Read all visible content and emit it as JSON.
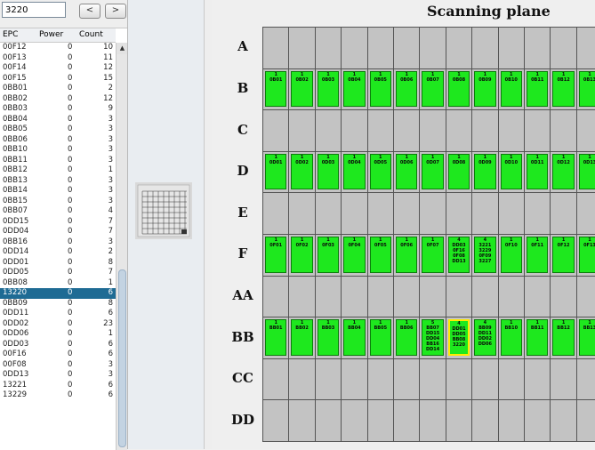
{
  "search": {
    "value": "3220"
  },
  "nav": {
    "prev": "<",
    "next": ">"
  },
  "table": {
    "headers": [
      "EPC",
      "Power",
      "Count"
    ],
    "rows": [
      [
        "00F12",
        "0",
        "10"
      ],
      [
        "00F13",
        "0",
        "11"
      ],
      [
        "00F14",
        "0",
        "12"
      ],
      [
        "00F15",
        "0",
        "15"
      ],
      [
        "0BB01",
        "0",
        "2"
      ],
      [
        "0BB02",
        "0",
        "12"
      ],
      [
        "0BB03",
        "0",
        "9"
      ],
      [
        "0BB04",
        "0",
        "3"
      ],
      [
        "0BB05",
        "0",
        "3"
      ],
      [
        "0BB06",
        "0",
        "3"
      ],
      [
        "0BB10",
        "0",
        "3"
      ],
      [
        "0BB11",
        "0",
        "3"
      ],
      [
        "0BB12",
        "0",
        "1"
      ],
      [
        "0BB13",
        "0",
        "3"
      ],
      [
        "0BB14",
        "0",
        "3"
      ],
      [
        "0BB15",
        "0",
        "3"
      ],
      [
        "0BB07",
        "0",
        "4"
      ],
      [
        "0DD15",
        "0",
        "7"
      ],
      [
        "0DD04",
        "0",
        "7"
      ],
      [
        "0BB16",
        "0",
        "3"
      ],
      [
        "0DD14",
        "0",
        "2"
      ],
      [
        "0DD01",
        "0",
        "8"
      ],
      [
        "0DD05",
        "0",
        "7"
      ],
      [
        "0BB08",
        "0",
        "1"
      ],
      [
        "13220",
        "0",
        "6"
      ],
      [
        "0BB09",
        "0",
        "8"
      ],
      [
        "0DD11",
        "0",
        "6"
      ],
      [
        "0DD02",
        "0",
        "23"
      ],
      [
        "0DD06",
        "0",
        "1"
      ],
      [
        "0DD03",
        "0",
        "6"
      ],
      [
        "00F16",
        "0",
        "6"
      ],
      [
        "00F08",
        "0",
        "3"
      ],
      [
        "0DD13",
        "0",
        "3"
      ],
      [
        "13221",
        "0",
        "6"
      ],
      [
        "13229",
        "0",
        "6"
      ]
    ],
    "selected_index": 24
  },
  "scanning_plane": {
    "title": "Scanning plane",
    "row_labels": [
      "A",
      "B",
      "C",
      "D",
      "E",
      "F",
      "AA",
      "BB",
      "CC",
      "DD"
    ],
    "rows": {
      "B": [
        {
          "count": "1",
          "ids": [
            "0B01"
          ]
        },
        {
          "count": "1",
          "ids": [
            "0B02"
          ]
        },
        {
          "count": "1",
          "ids": [
            "0B03"
          ]
        },
        {
          "count": "1",
          "ids": [
            "0B04"
          ]
        },
        {
          "count": "1",
          "ids": [
            "0B05"
          ]
        },
        {
          "count": "1",
          "ids": [
            "0B06"
          ]
        },
        {
          "count": "1",
          "ids": [
            "0B07"
          ]
        },
        {
          "count": "1",
          "ids": [
            "0B08"
          ]
        },
        {
          "count": "1",
          "ids": [
            "0B09"
          ]
        },
        {
          "count": "1",
          "ids": [
            "0B10"
          ]
        },
        {
          "count": "1",
          "ids": [
            "0B11"
          ]
        },
        {
          "count": "1",
          "ids": [
            "0B12"
          ]
        },
        {
          "count": "1",
          "ids": [
            "0B13"
          ]
        }
      ],
      "D": [
        {
          "count": "1",
          "ids": [
            "0D01"
          ]
        },
        {
          "count": "1",
          "ids": [
            "0D02"
          ]
        },
        {
          "count": "1",
          "ids": [
            "0D03"
          ]
        },
        {
          "count": "1",
          "ids": [
            "0D04"
          ]
        },
        {
          "count": "1",
          "ids": [
            "0D05"
          ]
        },
        {
          "count": "1",
          "ids": [
            "0D06"
          ]
        },
        {
          "count": "1",
          "ids": [
            "0D07"
          ]
        },
        {
          "count": "1",
          "ids": [
            "0D08"
          ]
        },
        {
          "count": "1",
          "ids": [
            "0D09"
          ]
        },
        {
          "count": "1",
          "ids": [
            "0D10"
          ]
        },
        {
          "count": "1",
          "ids": [
            "0D11"
          ]
        },
        {
          "count": "1",
          "ids": [
            "0D12"
          ]
        },
        {
          "count": "1",
          "ids": [
            "0D13"
          ]
        }
      ],
      "F": [
        {
          "count": "1",
          "ids": [
            "0F01"
          ]
        },
        {
          "count": "1",
          "ids": [
            "0F02"
          ]
        },
        {
          "count": "1",
          "ids": [
            "0F03"
          ]
        },
        {
          "count": "1",
          "ids": [
            "0F04"
          ]
        },
        {
          "count": "1",
          "ids": [
            "0F05"
          ]
        },
        {
          "count": "1",
          "ids": [
            "0F06"
          ]
        },
        {
          "count": "1",
          "ids": [
            "0F07"
          ]
        },
        {
          "count": "4",
          "ids": [
            "DD03",
            "0F16",
            "0F08",
            "DD13"
          ]
        },
        {
          "count": "4",
          "ids": [
            "3221",
            "3229",
            "0F09",
            "3227"
          ]
        },
        {
          "count": "1",
          "ids": [
            "0F10"
          ]
        },
        {
          "count": "1",
          "ids": [
            "0F11"
          ]
        },
        {
          "count": "1",
          "ids": [
            "0F12"
          ]
        },
        {
          "count": "1",
          "ids": [
            "0F13"
          ]
        }
      ],
      "BB": [
        {
          "count": "1",
          "ids": [
            "BB01"
          ]
        },
        {
          "count": "1",
          "ids": [
            "BB02"
          ]
        },
        {
          "count": "1",
          "ids": [
            "BB03"
          ]
        },
        {
          "count": "1",
          "ids": [
            "BB04"
          ]
        },
        {
          "count": "1",
          "ids": [
            "BB05"
          ]
        },
        {
          "count": "1",
          "ids": [
            "BB06"
          ]
        },
        {
          "count": "5",
          "ids": [
            "BB07",
            "DD15",
            "DD04",
            "BB16",
            "DD14"
          ]
        },
        {
          "count": "4",
          "ids": [
            "DD01",
            "DD05",
            "BB08",
            "3220"
          ],
          "selected": true
        },
        {
          "count": "4",
          "ids": [
            "BB09",
            "DD11",
            "DD02",
            "DD06"
          ]
        },
        {
          "count": "1",
          "ids": [
            "BB10"
          ]
        },
        {
          "count": "1",
          "ids": [
            "BB11"
          ]
        },
        {
          "count": "1",
          "ids": [
            "BB12"
          ]
        },
        {
          "count": "1",
          "ids": [
            "BB13"
          ]
        }
      ]
    }
  },
  "colors": {
    "tag_fill": "#1ee81e",
    "cell_fill": "#c3c3c3",
    "selection_highlight": "#ffea00",
    "table_selection": "#1e6b94"
  }
}
